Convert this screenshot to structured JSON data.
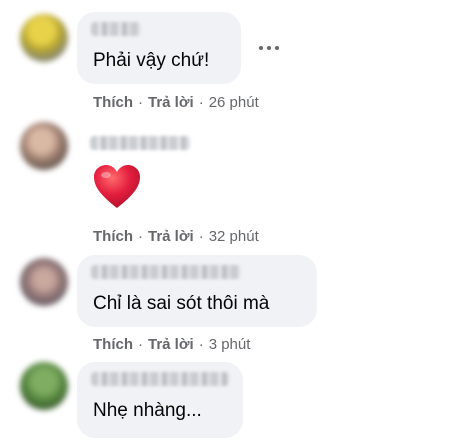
{
  "comments": [
    {
      "text": "Phải vậy chứ!",
      "actions": {
        "like": "Thích",
        "reply": "Trả lời",
        "time": "26 phút"
      }
    },
    {
      "reaction": "heart",
      "actions": {
        "like": "Thích",
        "reply": "Trả lời",
        "time": "32 phút"
      }
    },
    {
      "text": "Chỉ là sai sót thôi mà",
      "actions": {
        "like": "Thích",
        "reply": "Trả lời",
        "time": "3 phút"
      }
    },
    {
      "text": "Nhẹ nhàng..."
    }
  ],
  "separator": "·",
  "icons": {
    "more": "more-horizontal-icon",
    "heart": "heart-icon"
  },
  "colors": {
    "bubble": "#f0f2f5",
    "meta": "#65676b",
    "heart": "#e41e3f"
  }
}
